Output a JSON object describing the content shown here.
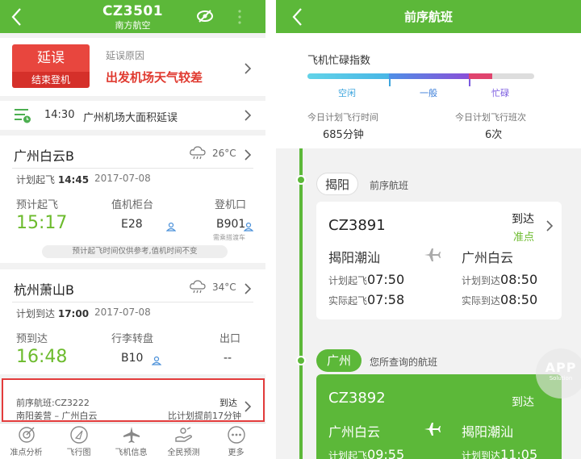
{
  "left": {
    "nav": {
      "flight": "CZ3501",
      "airline": "南方航空"
    },
    "delay": {
      "status": "延误",
      "sub": "结束登机",
      "reason_label": "延误原因",
      "reason": "出发机场天气较差"
    },
    "notice": {
      "time": "14:30",
      "text": "广州机场大面积延误"
    },
    "departure": {
      "city": "广州白云B",
      "temp": "26°C",
      "plan_label": "计划起飞",
      "plan_time": "14:45",
      "date": "2017-07-08",
      "est_label": "预计起飞",
      "est_time": "15:17",
      "counter_label": "值机柜台",
      "counter": "E28",
      "gate_label": "登机口",
      "gate": "B901",
      "gate_note": "需乘搭渡车",
      "tip": "预计起飞时间仅供参考,值机时间不变"
    },
    "arrival": {
      "city": "杭州萧山B",
      "temp": "34°C",
      "plan_label": "计划到达",
      "plan_time": "17:00",
      "date": "2017-07-08",
      "est_label": "预到达",
      "est_time": "16:48",
      "baggage_label": "行李转盘",
      "baggage": "B10",
      "exit_label": "出口",
      "exit": "--"
    },
    "prev": {
      "label": "前序航班:CZ3222",
      "route": "南阳姜营 – 广州白云",
      "status": "到达",
      "early": "比计划提前17分钟"
    },
    "tabs": [
      "准点分析",
      "飞行图",
      "飞机信息",
      "全民预测",
      "更多"
    ]
  },
  "right": {
    "title": "前序航班",
    "busy": {
      "title": "飞机忙碌指数",
      "levels": [
        "空闲",
        "一般",
        "忙碌"
      ],
      "plan_time_label": "今日计划飞行时间",
      "plan_time": "685分钟",
      "plan_count_label": "今日计划飞行班次",
      "plan_count": "6次",
      "colors": {
        "idle": "#5ac8e8",
        "normal": "#7b5be0",
        "busy": "#e0446e"
      }
    },
    "seg1": {
      "tag": "揭阳",
      "desc": "前序航班",
      "flight": "CZ3891",
      "status": "到达",
      "ontime": "准点",
      "from": "揭阳潮汕",
      "to": "广州白云",
      "plan_dep_label": "计划起飞",
      "plan_dep": "07:50",
      "act_dep_label": "实际起飞",
      "act_dep": "07:58",
      "plan_arr_label": "计划到达",
      "plan_arr": "08:50",
      "act_arr_label": "实际到达",
      "act_arr": "08:50"
    },
    "seg2": {
      "tag": "广州",
      "desc": "您所查询的航班",
      "flight": "CZ3892",
      "status": "到达",
      "from": "广州白云",
      "to": "揭阳潮汕",
      "plan_dep_label": "计划起飞",
      "plan_dep": "09:55",
      "plan_arr_label": "计划到达",
      "plan_arr": "11:05"
    },
    "watermark": {
      "app": "APP",
      "sub": "Solution"
    }
  }
}
